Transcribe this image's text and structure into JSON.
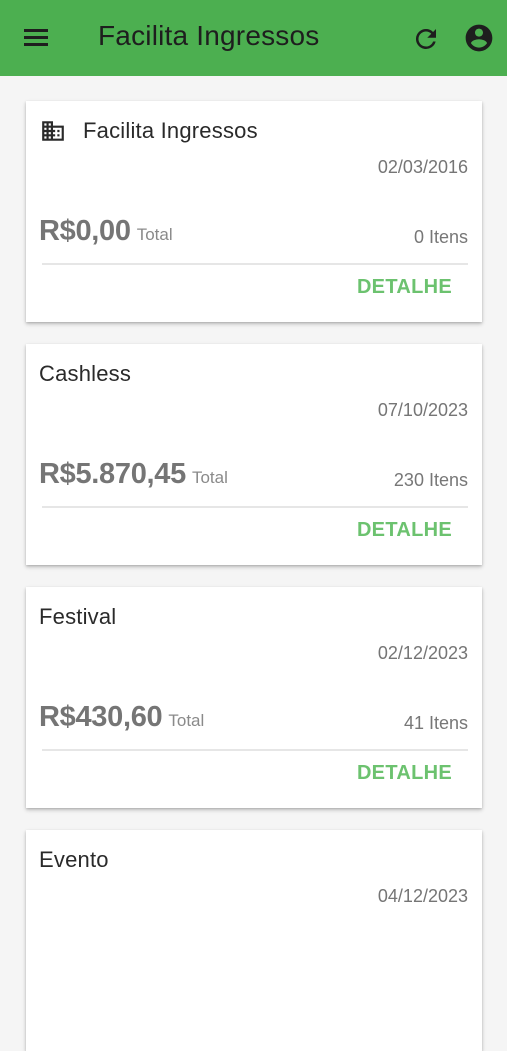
{
  "appbar": {
    "title": "Facilita Ingressos",
    "background": "#4caf50"
  },
  "icons": {
    "menu": "menu-icon",
    "refresh": "refresh-icon",
    "account": "account-circle-icon",
    "building": "building-icon"
  },
  "colors": {
    "accent": "#4caf50",
    "detail": "#6cc26f"
  },
  "events": [
    {
      "name": "Facilita Ingressos",
      "has_icon": true,
      "date": "02/03/2016",
      "amount": "R$0,00",
      "total_label": "Total",
      "count": "0",
      "items_label": "Itens",
      "action": "DETALHE"
    },
    {
      "name": "Cashless",
      "has_icon": false,
      "date": "07/10/2023",
      "amount": "R$5.870,45",
      "total_label": "Total",
      "count": "230",
      "items_label": "Itens",
      "action": "DETALHE"
    },
    {
      "name": "Festival",
      "has_icon": false,
      "date": "02/12/2023",
      "amount": "R$430,60",
      "total_label": "Total",
      "count": "41",
      "items_label": "Itens",
      "action": "DETALHE"
    },
    {
      "name": "Evento",
      "has_icon": false,
      "date": "04/12/2023",
      "amount": "",
      "total_label": "",
      "count": "",
      "items_label": "",
      "action": ""
    }
  ]
}
